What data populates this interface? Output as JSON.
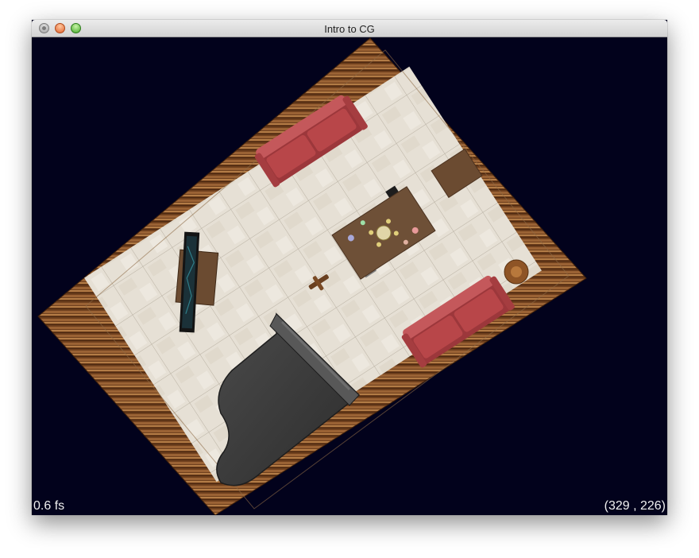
{
  "window": {
    "title": "Intro to CG"
  },
  "hud": {
    "fps": "0.6 fs",
    "coords": "(329 , 226)"
  },
  "scene": {
    "background_color": "#02021c",
    "floor_border_color": "#7a4a24",
    "floor_tile_color": "#e3ddd2",
    "sofa_color": "#b74649",
    "table_color": "#6e5037",
    "piano_color": "#3a3a3a",
    "tv_screen_color": "#1b3138",
    "objects": [
      "floor",
      "sofa",
      "sofa",
      "dining-table",
      "chairs",
      "side-table",
      "tv-stand",
      "television",
      "grand-piano",
      "plant-pot",
      "small-stool"
    ]
  }
}
